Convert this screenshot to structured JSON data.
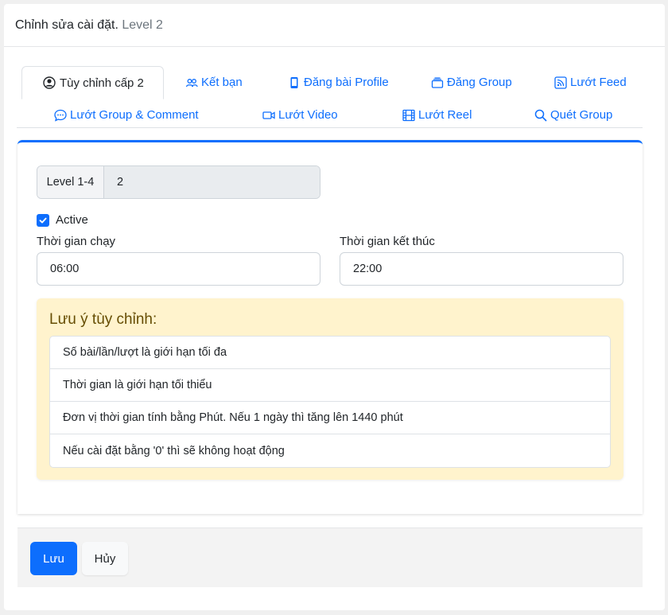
{
  "header": {
    "title": "Chỉnh sửa cài đặt.",
    "subtitle": "Level 2"
  },
  "tabs": [
    {
      "label": "Tùy chỉnh cấp 2",
      "icon": "person-circle-icon",
      "active": true
    },
    {
      "label": "Kết bạn",
      "icon": "people-icon"
    },
    {
      "label": "Đăng bài Profile",
      "icon": "phone-icon"
    },
    {
      "label": "Đăng Group",
      "icon": "stack-icon"
    },
    {
      "label": "Lướt Feed",
      "icon": "rss-icon"
    },
    {
      "label": "Lướt Group & Comment",
      "icon": "chat-dots-icon"
    },
    {
      "label": "Lướt Video",
      "icon": "camera-video-icon"
    },
    {
      "label": "Lướt Reel",
      "icon": "film-icon"
    },
    {
      "label": "Quét Group",
      "icon": "search-icon"
    }
  ],
  "level": {
    "label": "Level 1-4",
    "value": "2"
  },
  "active": {
    "label": "Active",
    "checked": true
  },
  "run_time": {
    "label": "Thời gian chạy",
    "value": "06:00"
  },
  "end_time": {
    "label": "Thời gian kết thúc",
    "value": "22:00"
  },
  "notes": {
    "title": "Lưu ý tùy chỉnh:",
    "items": [
      "Số bài/lần/lượt là giới hạn tối đa",
      "Thời gian là giới hạn tối thiểu",
      "Đơn vị thời gian tính bằng Phút. Nếu 1 ngày thì tăng lên 1440 phút",
      "Nếu cài đặt bằng '0' thì sẽ không hoạt động"
    ]
  },
  "footer": {
    "save_label": "Lưu",
    "cancel_label": "Hủy"
  },
  "colors": {
    "primary": "#0d6efd",
    "alert_bg": "#fff3cd",
    "alert_text": "#664d03"
  }
}
